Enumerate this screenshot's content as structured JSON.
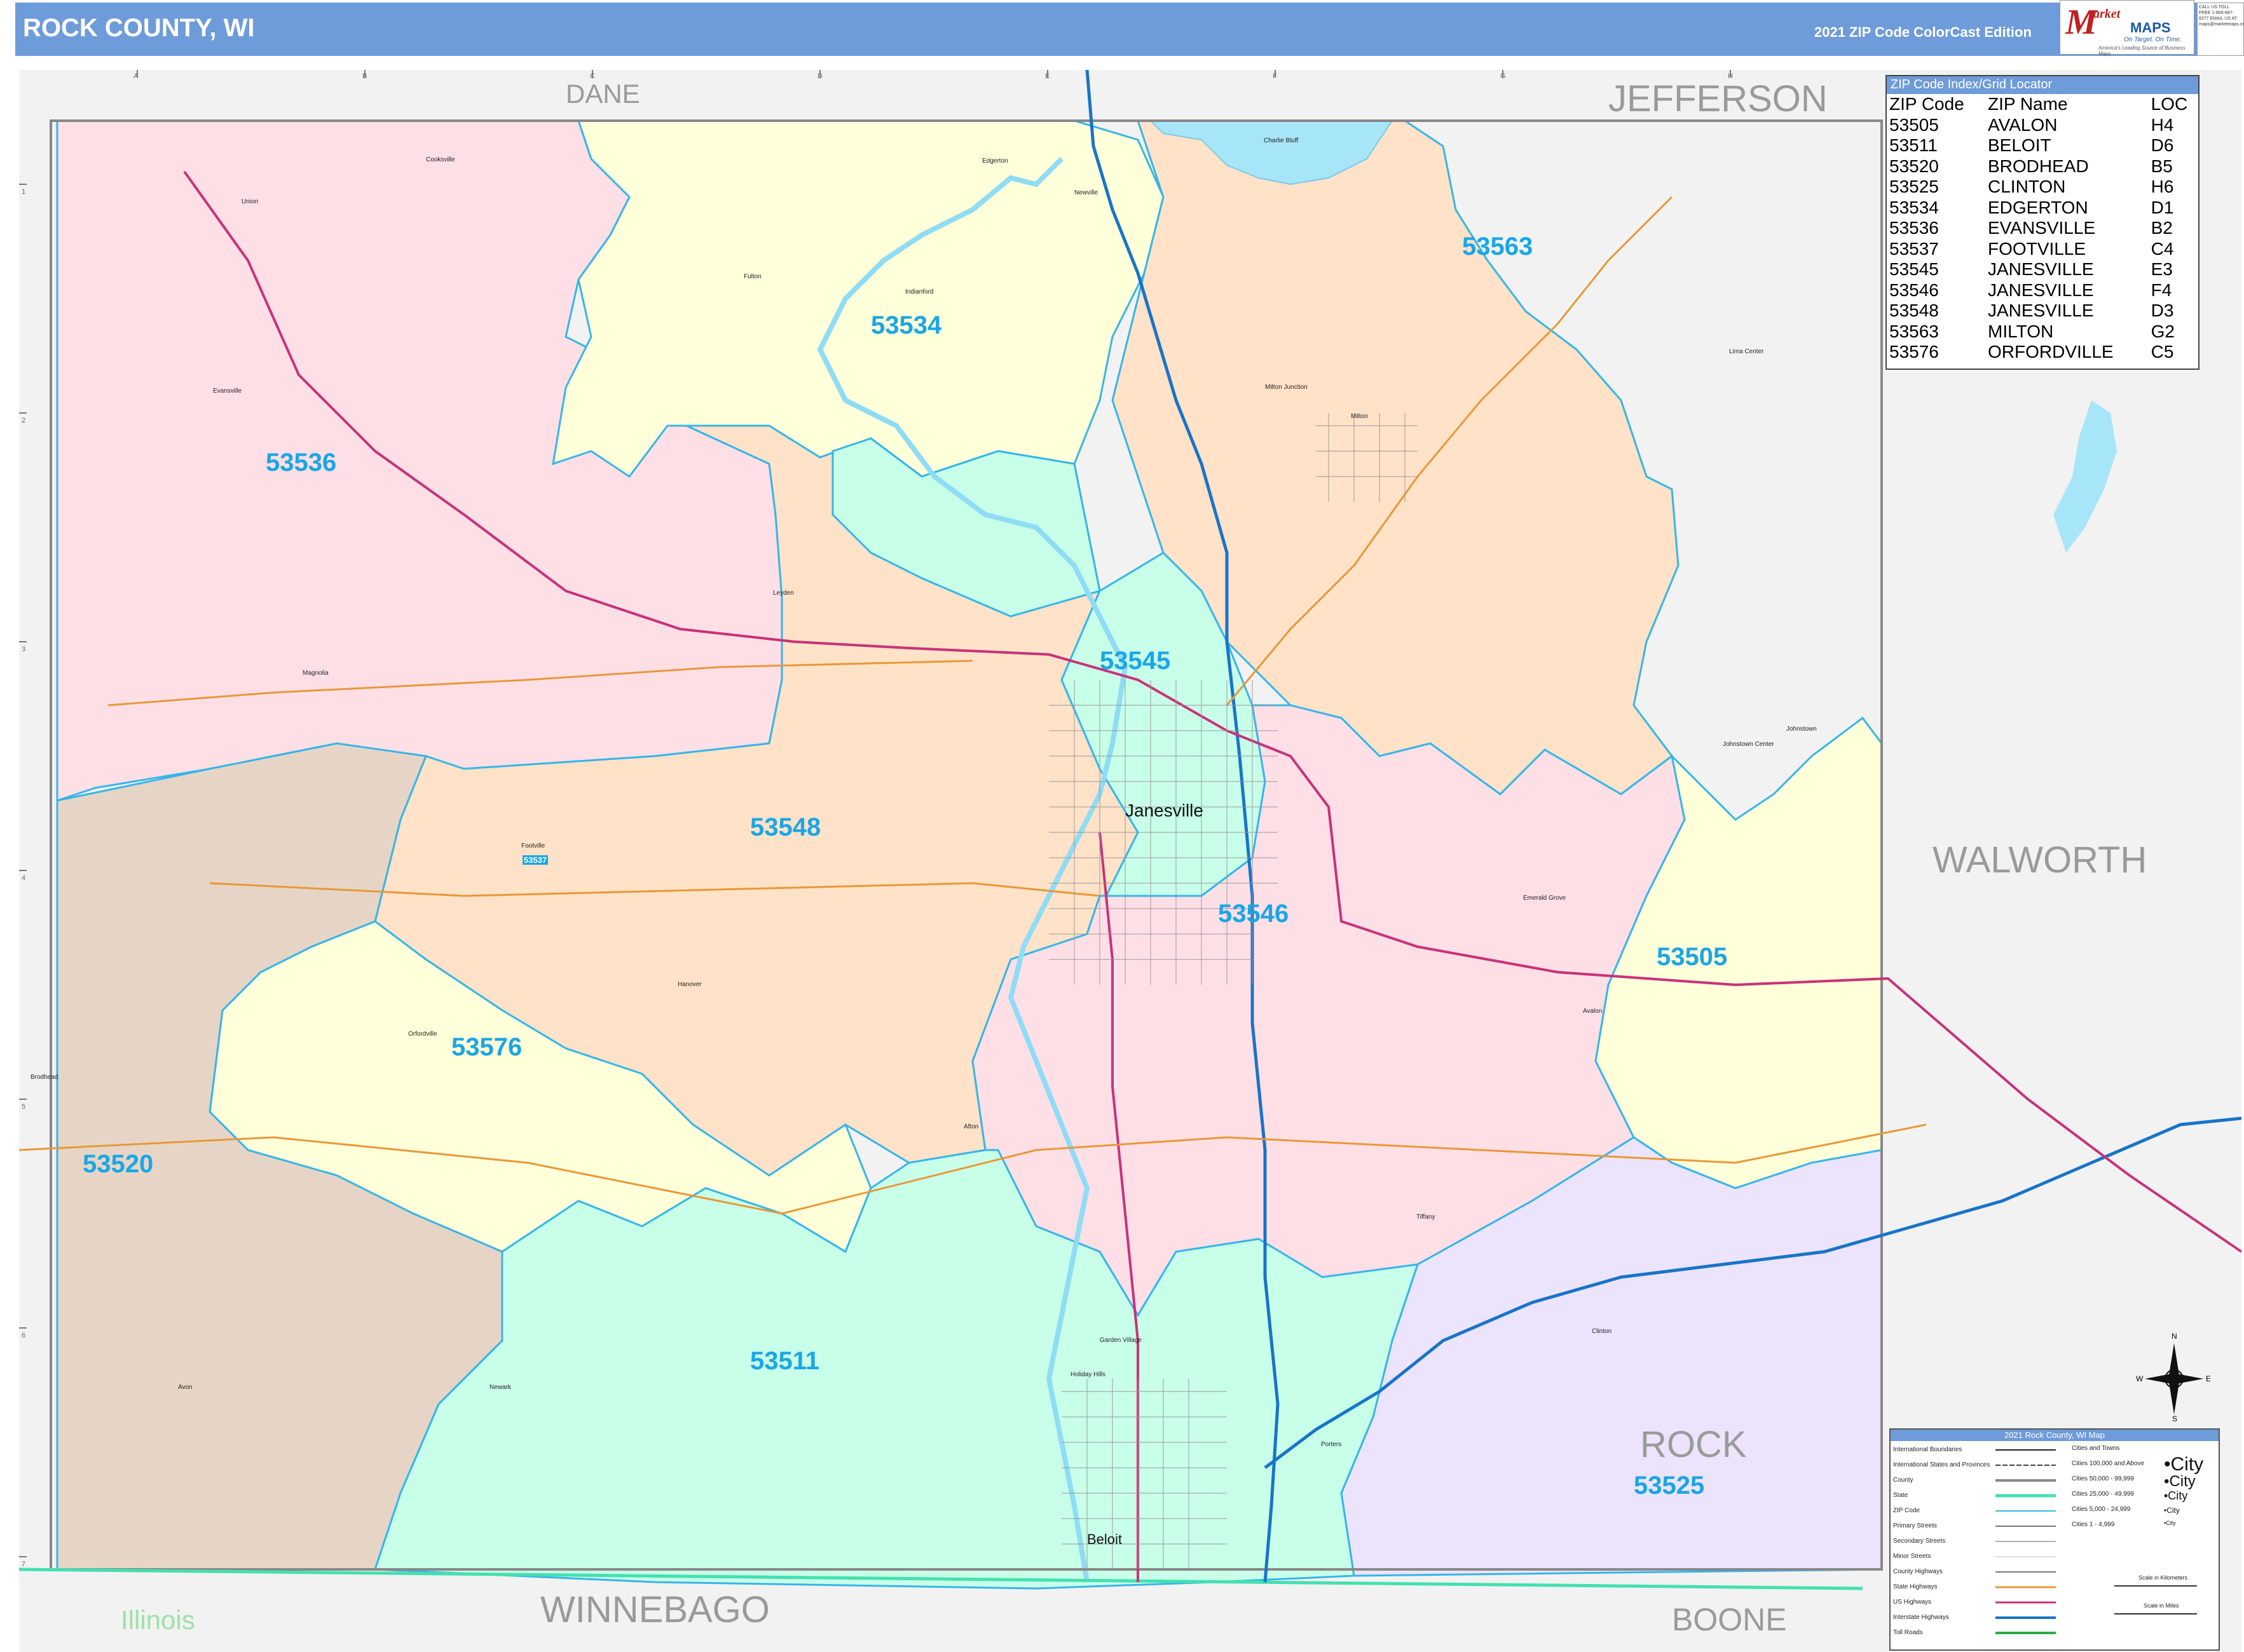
{
  "header": {
    "title": "ROCK COUNTY, WI",
    "edition": "2021 ZIP Code ColorCast Edition",
    "logo_m": "M",
    "logo_brand1": "arket",
    "logo_brand2": "MAPS",
    "logo_tagline": "On Target. On Time.",
    "logo_tagline2": "America's Leading Source of Business Maps",
    "contact": "CALL US TOLL FREE 1-800-687-6277 EMAIL US AT: maps@marketmaps.com"
  },
  "colors": {
    "header_bg": "#6e9bd9",
    "zip_label": "#1aa6e6",
    "boundary": "#36b6e8",
    "zip_53505": "#ffffd9",
    "zip_53511": "#c8ffe8",
    "zip_53520": "#e6d5c6",
    "zip_53525": "#ece4fc",
    "zip_53534": "#ffffd9",
    "zip_53536": "#ffdfe6",
    "zip_53545": "#c8ffe8",
    "zip_53546": "#ffdfe6",
    "zip_53548": "#ffe2c8",
    "zip_53563": "#ffe2c8",
    "zip_53576": "#ffffd9",
    "outside_county": "#f2f2f2",
    "water": "#a6e6f8"
  },
  "zip_labels": [
    {
      "zip": "53534"
    },
    {
      "zip": "53563"
    },
    {
      "zip": "53536"
    },
    {
      "zip": "53545"
    },
    {
      "zip": "53548"
    },
    {
      "zip": "53546"
    },
    {
      "zip": "53505"
    },
    {
      "zip": "53576"
    },
    {
      "zip": "53520"
    },
    {
      "zip": "53511"
    },
    {
      "zip": "53525"
    },
    {
      "zip": "53537"
    }
  ],
  "neighbors": {
    "dane": "DANE",
    "jefferson": "JEFFERSON",
    "walworth": "WALWORTH",
    "rock": "ROCK",
    "winnebago": "WINNEBAGO",
    "boone": "BOONE",
    "illinois": "Illinois"
  },
  "cities": {
    "janesville": "Janesville",
    "beloit": "Beloit",
    "milton": "Milton",
    "edgerton": "Edgerton",
    "evansville": "Evansville",
    "footville": "Footville",
    "orfordville": "Orfordville",
    "clinton": "Clinton",
    "brodhead": "Brodhead",
    "avalon": "Avalon",
    "cooksville": "Cooksville",
    "union": "Union",
    "magnolia": "Magnolia",
    "leyden": "Leyden",
    "fulton": "Fulton",
    "indianford": "Indianford",
    "newville": "Newville",
    "charley_bluff": "Charlie Bluff",
    "milton_junction": "Milton Junction",
    "lima_center": "Lima Center",
    "johnstown_center": "Johnstown Center",
    "johnstown": "Johnstown",
    "emerald_grove": "Emerald Grove",
    "hanover": "Hanover",
    "afton": "Afton",
    "tiffany": "Tiffany",
    "garden_village": "Garden Village",
    "hollday_hills": "Holiday Hills",
    "newark": "Newark",
    "avon": "Avon",
    "porters": "Porters"
  },
  "grid": {
    "columns": [
      "A",
      "B",
      "C",
      "D",
      "E",
      "F",
      "G",
      "H"
    ],
    "rows": [
      "1",
      "2",
      "3",
      "4",
      "5",
      "6",
      "7"
    ]
  },
  "index": {
    "title": "ZIP Code Index/Grid Locator",
    "columns": [
      "ZIP Code",
      "ZIP Name",
      "LOC"
    ],
    "rows": [
      [
        "53505",
        "AVALON",
        "H4"
      ],
      [
        "53511",
        "BELOIT",
        "D6"
      ],
      [
        "53520",
        "BRODHEAD",
        "B5"
      ],
      [
        "53525",
        "CLINTON",
        "H6"
      ],
      [
        "53534",
        "EDGERTON",
        "D1"
      ],
      [
        "53536",
        "EVANSVILLE",
        "B2"
      ],
      [
        "53537",
        "FOOTVILLE",
        "C4"
      ],
      [
        "53545",
        "JANESVILLE",
        "E3"
      ],
      [
        "53546",
        "JANESVILLE",
        "F4"
      ],
      [
        "53548",
        "JANESVILLE",
        "D3"
      ],
      [
        "53563",
        "MILTON",
        "G2"
      ],
      [
        "53576",
        "ORFORDVILLE",
        "C5"
      ]
    ]
  },
  "legend": {
    "title": "2021 Rock County, WI Map",
    "items": [
      "International Boundaries",
      "International States and Provinces",
      "County",
      "State",
      "ZIP Code",
      "Primary Streets",
      "Secondary Streets",
      "Minor Streets",
      "County Highways",
      "State Highways",
      "US Highways",
      "Interstate Highways",
      "Toll Roads"
    ],
    "city_classes": [
      "Cities and Towns",
      "Cities 100,000 and Above",
      "Cities 50,000 - 99,999",
      "Cities 25,000 - 49,999",
      "Cities 5,000 - 24,999",
      "Cities 1 - 4,999"
    ],
    "city_examples": [
      "•City",
      "•City",
      "•City",
      "•City",
      "•City"
    ],
    "scale_km": "Scale in Kilometers",
    "scale_mi": "Scale in Miles"
  },
  "compass": {
    "n": "N",
    "s": "S",
    "e": "E",
    "w": "W"
  }
}
